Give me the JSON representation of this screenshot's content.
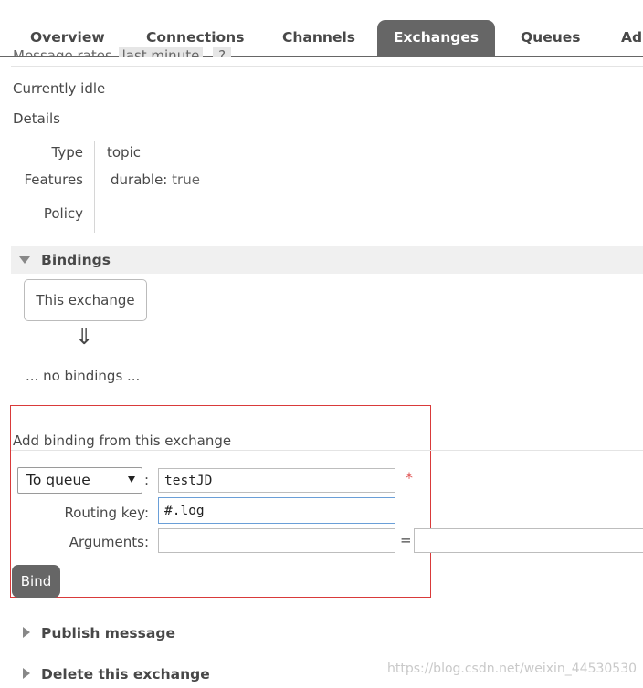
{
  "tabs": [
    {
      "label": "Overview",
      "active": false
    },
    {
      "label": "Connections",
      "active": false
    },
    {
      "label": "Channels",
      "active": false
    },
    {
      "label": "Exchanges",
      "active": true
    },
    {
      "label": "Queues",
      "active": false
    },
    {
      "label": "Adr",
      "active": false
    }
  ],
  "message_rates": {
    "label": "Message rates",
    "period": "last minute",
    "help": "?"
  },
  "status": "Currently idle",
  "details": {
    "heading": "Details",
    "type_label": "Type",
    "type_value": "topic",
    "features_label": "Features",
    "feature_key": "durable:",
    "feature_value": "true",
    "policy_label": "Policy"
  },
  "bindings": {
    "title": "Bindings",
    "source_box": "This exchange",
    "arrow": "⇓",
    "empty": "... no bindings ..."
  },
  "add_binding": {
    "heading": "Add binding from this exchange",
    "destination_type": "To queue",
    "colon": ":",
    "destination_value": "testJD",
    "required_mark": "*",
    "routing_key_label": "Routing key:",
    "routing_key_value": "#.log",
    "arguments_label": "Arguments:",
    "equals": "=",
    "bind_button": "Bind"
  },
  "collapsed_sections": {
    "publish": "Publish message",
    "delete": "Delete this exchange"
  },
  "watermark": "https://blog.csdn.net/weixin_44530530"
}
